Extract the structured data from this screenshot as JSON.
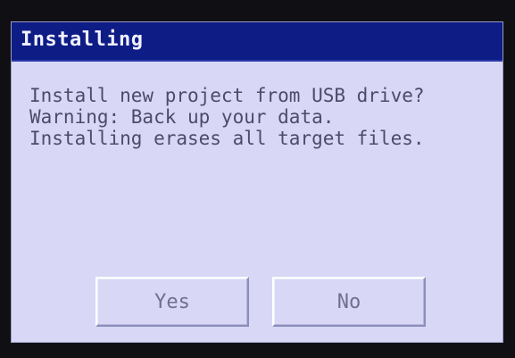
{
  "dialog": {
    "title": "Installing",
    "message_lines": [
      "Install new project from USB drive?",
      "Warning: Back up your data.",
      "Installing erases all target files."
    ],
    "yes_label": "Yes",
    "no_label": "No"
  },
  "colors": {
    "titlebar": "#0e1c86",
    "title_text": "#f2f2ff",
    "screen_background": "#d8d8f6",
    "message_text": "#4c4c6a",
    "button_text": "#70708e"
  }
}
